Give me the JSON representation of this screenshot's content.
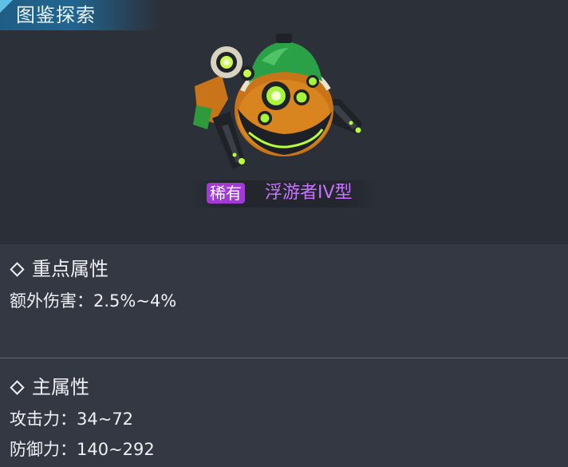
{
  "header": {
    "title": "图鉴探索"
  },
  "item": {
    "rarity": "稀有",
    "name": "浮游者IV型"
  },
  "key_attributes": {
    "title": "重点属性",
    "stats": [
      {
        "label": "额外伤害：2.5%~4%"
      }
    ]
  },
  "main_attributes": {
    "title": "主属性",
    "stats": [
      {
        "label": "攻击力：34~72"
      },
      {
        "label": "防御力：140~292"
      }
    ]
  },
  "colors": {
    "rarity_badge": "#a43ad6",
    "item_name": "#c873ff",
    "header_tab": "#216691",
    "panel": "#343842"
  }
}
